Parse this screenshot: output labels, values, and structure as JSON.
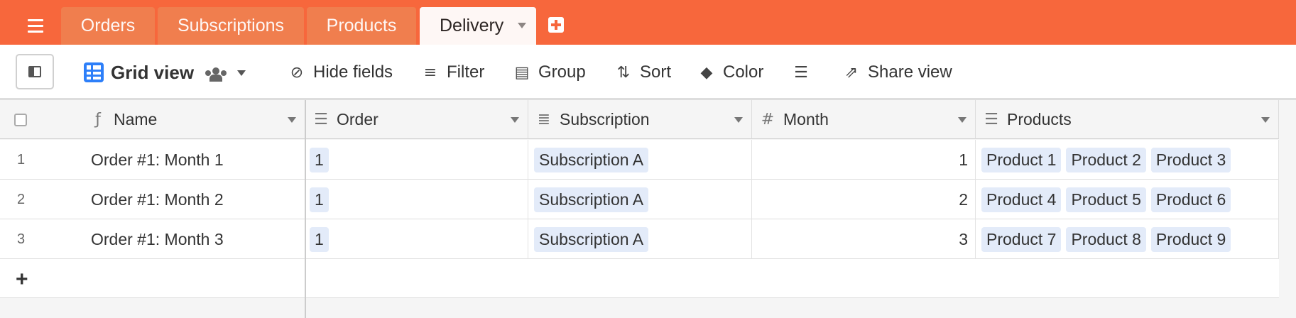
{
  "tabs": [
    {
      "label": "Orders"
    },
    {
      "label": "Subscriptions"
    },
    {
      "label": "Products"
    },
    {
      "label": "Delivery"
    }
  ],
  "toolbar": {
    "view_name": "Grid view",
    "hide_fields": "Hide fields",
    "filter": "Filter",
    "group": "Group",
    "sort": "Sort",
    "color": "Color",
    "share_view": "Share view"
  },
  "columns": [
    {
      "label": "Name",
      "icon": "formula-icon"
    },
    {
      "label": "Order",
      "icon": "link-icon"
    },
    {
      "label": "Subscription",
      "icon": "lookup-icon"
    },
    {
      "label": "Month",
      "icon": "number-icon"
    },
    {
      "label": "Products",
      "icon": "link-icon"
    }
  ],
  "rows": [
    {
      "num": "1",
      "name": "Order #1: Month 1",
      "order": "1",
      "subscription": "Subscription A",
      "month": "1",
      "products": [
        "Product 1",
        "Product 2",
        "Product 3"
      ]
    },
    {
      "num": "2",
      "name": "Order #1: Month 2",
      "order": "1",
      "subscription": "Subscription A",
      "month": "2",
      "products": [
        "Product 4",
        "Product 5",
        "Product 6"
      ]
    },
    {
      "num": "3",
      "name": "Order #1: Month 3",
      "order": "1",
      "subscription": "Subscription A",
      "month": "3",
      "products": [
        "Product 7",
        "Product 8",
        "Product 9"
      ]
    }
  ],
  "add_row": "+",
  "colors": {
    "accent": "#f7673c",
    "view_icon": "#2d7ff9",
    "chip": "#e3ebf9"
  }
}
